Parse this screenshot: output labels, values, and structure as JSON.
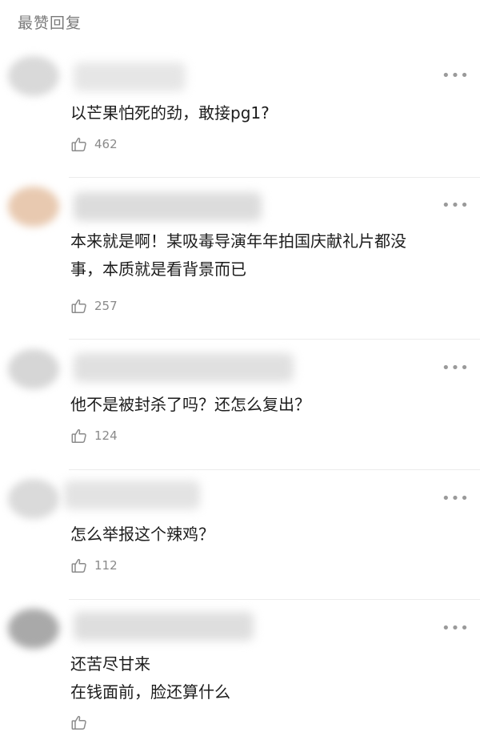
{
  "header": {
    "title": "最赞回复"
  },
  "more_glyph": "•••",
  "icons": {
    "like": "thumbs-up-icon",
    "more": "more-dots-icon"
  },
  "comments": [
    {
      "text": "以芒果怕死的劲，敢接pg1?",
      "likes": "462"
    },
    {
      "text": "本来就是啊！某吸毒导演年年拍国庆献礼片都没\n事，本质就是看背景而已",
      "likes": "257"
    },
    {
      "text": "他不是被封杀了吗？还怎么复出？",
      "likes": "124"
    },
    {
      "text": "怎么举报这个辣鸡？",
      "likes": "112"
    },
    {
      "text": "还苦尽甘来\n在钱面前，脸还算什么",
      "likes": ""
    }
  ]
}
